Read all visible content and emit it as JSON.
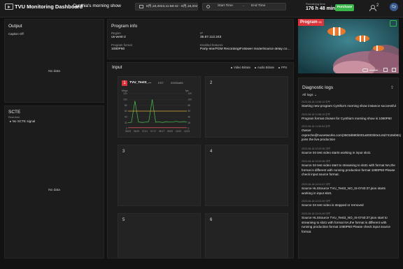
{
  "header": {
    "app_title": "TVU Monitoring Dashboard",
    "show_title": "Cynthia's morning show",
    "date_range": "8月,18,2023,11:58:42 - 8月,18,2023,12:11:00",
    "start_time": "Start Time",
    "end_time": "End Time",
    "remaining_label": "Remaining time",
    "remaining_value": "176 h 48 mins",
    "purchase_label": "Purchase",
    "user_count": "2",
    "avatar_initials": "Cy"
  },
  "output": {
    "title": "Output",
    "caption_label": "Caption",
    "caption_value": "Off",
    "no_data": "No data"
  },
  "scte": {
    "title": "SCTE",
    "realtime_label": "Real-time",
    "signal_text": "No SCTE signal",
    "no_data": "No data"
  },
  "program_info": {
    "title": "Program info",
    "region_label": "Region",
    "region_value": "us-west-2",
    "ip_label": "IP",
    "ip_value": "35.87.112.243",
    "format_label": "Program format",
    "format_value": "1080P60",
    "features_label": "Enabled features",
    "features_value": "Party-line/PGM Recording/Follower mode/Source delay control..."
  },
  "input": {
    "title": "Input",
    "legend": [
      "Video Bitrate",
      "Audio Bitrate",
      "FPS"
    ],
    "slots": [
      {
        "num": "1",
        "name": "TVU_Test3_...",
        "tz": "EST",
        "status": "00000dff4"
      },
      {
        "num": "2"
      },
      {
        "num": "3"
      },
      {
        "num": "4"
      },
      {
        "num": "5"
      },
      {
        "num": "6"
      }
    ]
  },
  "chart_data": {
    "type": "line",
    "ylabel": "Mbps",
    "y2label": "fps",
    "ylim": [
      0,
      120
    ],
    "y2lim": [
      0,
      120
    ],
    "yticks": [
      "120",
      "100",
      "80",
      "60",
      "40",
      "20",
      "0"
    ],
    "categories": [
      "06:09",
      "06:09",
      "07:01",
      "07:17",
      "08:17",
      "09:09",
      "10:02",
      "10:23"
    ],
    "series": [
      {
        "name": "Video Bitrate",
        "color": "#4cc04f",
        "values": [
          20,
          22,
          95,
          23,
          21,
          22,
          24,
          100,
          22,
          23,
          21,
          24,
          22,
          23,
          25,
          22,
          24,
          23
        ]
      },
      {
        "name": "FPS",
        "color": "#d8a93b",
        "values": [
          60,
          60,
          60,
          60,
          60,
          60,
          60,
          60,
          60,
          60,
          60,
          60,
          60,
          60,
          60,
          60,
          60,
          60
        ]
      },
      {
        "name": "Audio Bitrate",
        "color": "#e35555",
        "values": [
          3,
          3,
          3,
          3,
          3,
          3,
          3,
          3,
          3,
          3,
          3,
          3,
          3,
          3,
          3,
          3,
          3,
          3
        ]
      }
    ]
  },
  "program": {
    "badge": "Program",
    "badge_channel": "01",
    "colors": {
      "badge": "#d9353a",
      "purchase": "#3ab54a"
    }
  },
  "logs": {
    "title": "Diagnostic logs",
    "filter": "All logs",
    "entries": [
      {
        "time": "2023-08-18 11:58:13 中午",
        "msg": "Starting new program Cynthia's morning show instance successful"
      },
      {
        "time": "2023-08-18 11:58:13 中午",
        "msg": "Program format chosen for Cynthia's morning show is 1080P60"
      },
      {
        "time": "2023-08-18 11:59:54 中午",
        "msg": "Owner cspreche@tvunetworks.com(3603d680b001a0003b0e1c6d7418eb61) joins the live production"
      },
      {
        "time": "2023-08-18 12:00:38 中午",
        "msg": "Source 04 test video starts working in input slot1"
      },
      {
        "time": "2023-08-18 12:00:38 中午",
        "msg": "Source 04 test video start to streaming to slot1 with format NA,the format is different with running production format 1080P60 Please check input source format."
      },
      {
        "time": "2023-08-18 12:01:47 中午",
        "msg": "Source HLSSource TVU_Test3_NO_IS-0740:37.json starts working in input slot1"
      },
      {
        "time": "2023-08-18 12:01:49 中午",
        "msg": "Source 04 test video is stopped or removed"
      },
      {
        "time": "2023-08-18 12:01:49 中午",
        "msg": "Source HLSSource TVU_Test3_NO_IS-0740:37.json start to streaming to slot1 with format NA,the format is different with running production format 1080P60 Please check input source format."
      }
    ]
  }
}
